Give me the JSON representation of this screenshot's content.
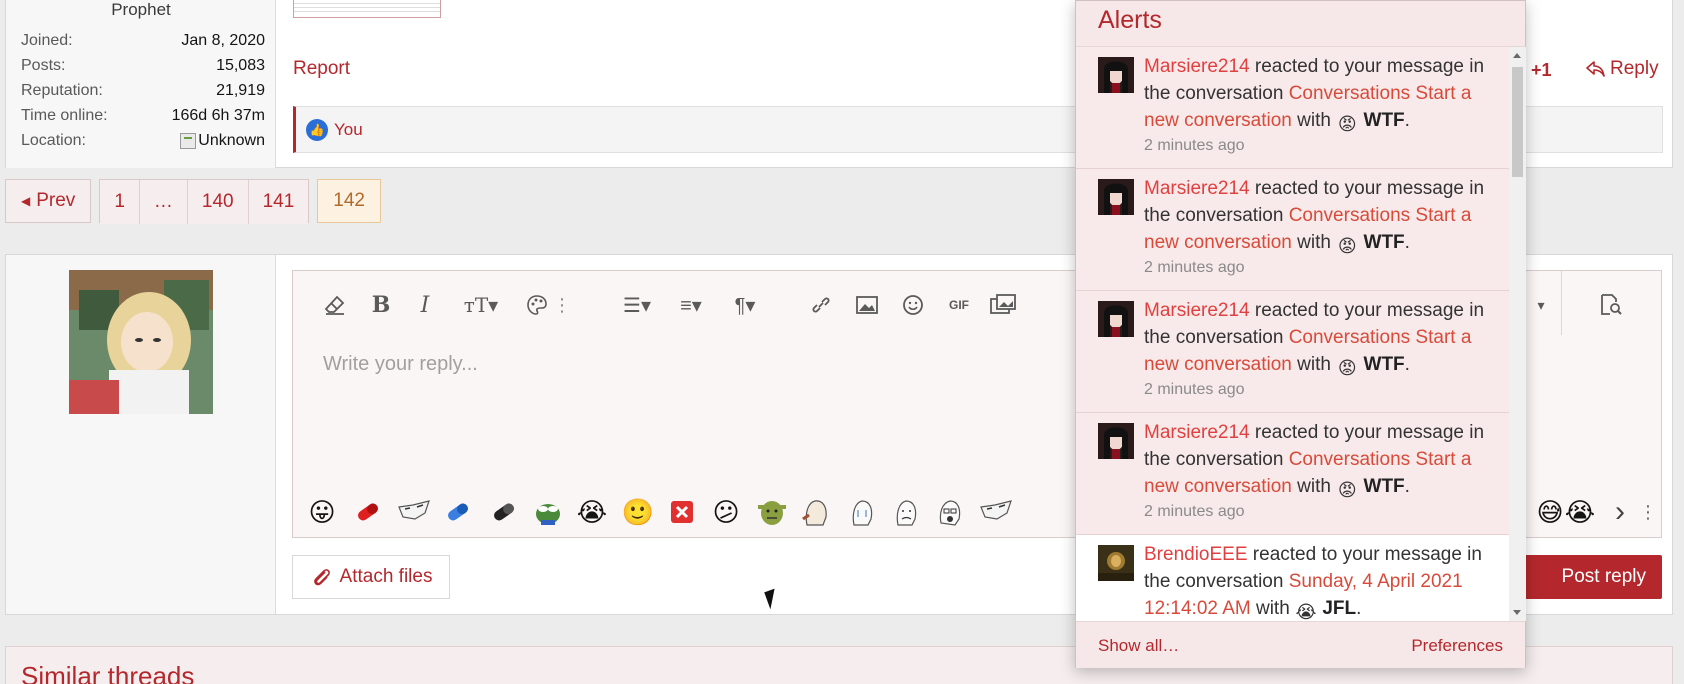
{
  "post": {
    "user_title": "Prophet",
    "stats": [
      {
        "label": "Joined:",
        "value": "Jan 8, 2020"
      },
      {
        "label": "Posts:",
        "value": "15,083"
      },
      {
        "label": "Reputation:",
        "value": "21,919"
      },
      {
        "label": "Time online:",
        "value": "166d 6h 37m"
      },
      {
        "label": "Location:",
        "value": "Unknown"
      }
    ],
    "report_label": "Report",
    "plus_one": "+1",
    "reply_label": "Reply",
    "likes_text": "You"
  },
  "pagination": {
    "prev": "Prev",
    "pages": [
      "1",
      "…",
      "140",
      "141",
      "142"
    ],
    "current": "142"
  },
  "editor": {
    "placeholder": "Write your reply...",
    "gif_label": "GIF",
    "attach_label": "Attach files",
    "post_reply_label": "Post reply"
  },
  "similar": {
    "title": "Similar threads"
  },
  "alerts": {
    "title": "Alerts",
    "items": [
      {
        "user": "Marsiere214",
        "text1": " reacted to your message in the conversation ",
        "content": "Conversations Start a new conversation",
        "text2": " with ",
        "reaction": "WTF",
        "suffix": ".",
        "time": "2 minutes ago",
        "read": false
      },
      {
        "user": "Marsiere214",
        "text1": " reacted to your message in the conversation ",
        "content": "Conversations Start a new conversation",
        "text2": " with ",
        "reaction": "WTF",
        "suffix": ".",
        "time": "2 minutes ago",
        "read": false
      },
      {
        "user": "Marsiere214",
        "text1": " reacted to your message in the conversation ",
        "content": "Conversations Start a new conversation",
        "text2": " with ",
        "reaction": "WTF",
        "suffix": ".",
        "time": "2 minutes ago",
        "read": false
      },
      {
        "user": "Marsiere214",
        "text1": " reacted to your message in the conversation ",
        "content": "Conversations Start a new conversation",
        "text2": " with ",
        "reaction": "WTF",
        "suffix": ".",
        "time": "2 minutes ago",
        "read": false
      },
      {
        "user": "BrendioEEE",
        "text1": " reacted to your message in the conversation ",
        "content": "Sunday, 4 April 2021 12:14:02 AM",
        "text2": " with ",
        "reaction": "JFL",
        "suffix": ".",
        "time": "",
        "read": true
      }
    ],
    "show_all": "Show all…",
    "preferences": "Preferences"
  },
  "colors": {
    "accent": "#b4282d",
    "alert_unread_bg": "#f8eaea"
  }
}
